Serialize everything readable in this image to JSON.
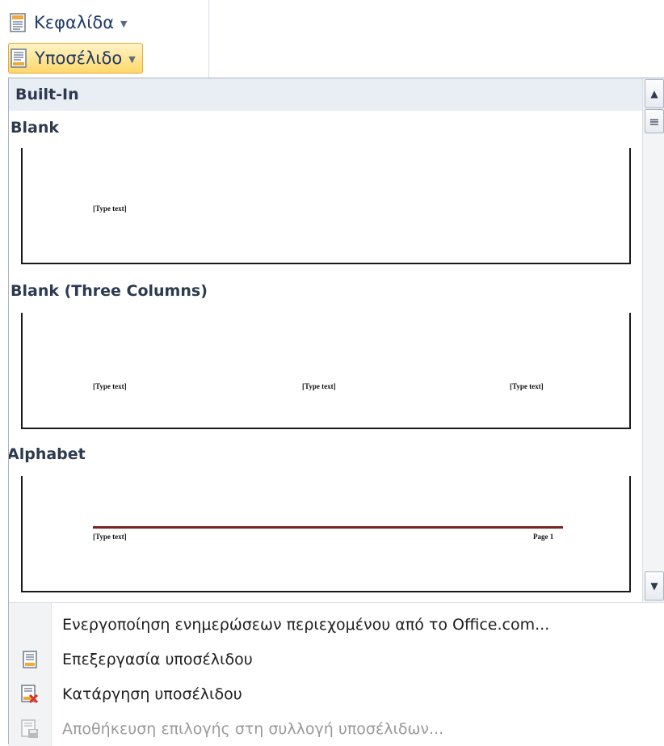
{
  "ribbon": {
    "header_button": {
      "label": "Κεφαλίδα",
      "icon": "header-doc-icon"
    },
    "footer_button": {
      "label": "Υποσέλιδο",
      "icon": "footer-doc-icon"
    }
  },
  "gallery": {
    "category": "Built-In",
    "items": [
      {
        "title": "Blank",
        "texts": [
          "[Type text]"
        ]
      },
      {
        "title": "Blank (Three Columns)",
        "texts": [
          "[Type text]",
          "[Type text]",
          "[Type text]"
        ]
      },
      {
        "title": "Alphabet",
        "texts": [
          "[Type text]",
          "Page 1"
        ]
      }
    ],
    "scroll_icons": {
      "up": "scroll-up-arrow",
      "more": "gallery-more-icon",
      "down": "scroll-down-arrow"
    }
  },
  "menu": {
    "items": [
      {
        "label": "Ενεργοποίηση ενημερώσεων περιεχομένου από το Office.com...",
        "icon": "",
        "enabled": true
      },
      {
        "label": "Επεξεργασία υποσέλιδου",
        "icon": "edit-footer-icon",
        "enabled": true
      },
      {
        "label": "Κατάργηση υποσέλιδου",
        "icon": "remove-footer-icon",
        "enabled": true
      },
      {
        "label": "Αποθήκευση επιλογής στη συλλογή υποσέλιδων...",
        "icon": "save-footer-icon",
        "enabled": false
      }
    ]
  },
  "colors": {
    "accent_highlight": "#ffd86b",
    "alphabet_rule": "#7a2323",
    "category_bg": "#e9edf4"
  }
}
